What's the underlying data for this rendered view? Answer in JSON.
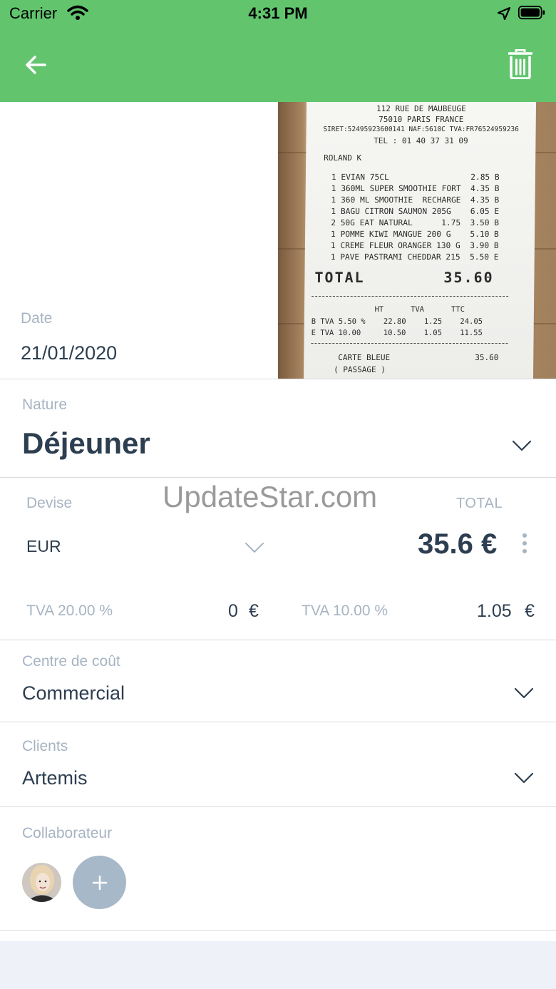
{
  "status_bar": {
    "carrier": "Carrier",
    "time": "4:31 PM"
  },
  "colors": {
    "header": "#62c56e",
    "label": "#a7b4c2",
    "text": "#2d3e50",
    "add_button": "#a7b8c8"
  },
  "icons": {
    "back": "arrow-left-icon",
    "delete": "trash-icon",
    "dropdown": "chevron-down-icon",
    "more": "more-vertical-icon",
    "add": "plus-icon"
  },
  "receipt": {
    "address1": "112 RUE DE MAUBEUGE",
    "address2": "75010 PARIS FRANCE",
    "siret": "SIRET:52495923600141 NAF:5610C TVA:FR76524959236",
    "tel": "TEL : 01 40 37 31 09",
    "cashier": "ROLAND K",
    "items": [
      "1 EVIAN 75CL                 2.85 B",
      "1 360ML SUPER SMOOTHIE FORT  4.35 B",
      "1 360 ML SMOOTHIE  RECHARGE  4.35 B",
      "1 BAGU CITRON SAUMON 205G    6.05 E",
      "2 50G EAT NATURAL      1.75  3.50 B",
      "1 POMME KIWI MANGUE 200 G    5.10 B",
      "1 CREME FLEUR ORANGER 130 G  3.90 B",
      "1 PAVE PASTRAMI CHEDDAR 215  5.50 E"
    ],
    "total_label": "TOTAL",
    "total_value": "35.60",
    "tax_header": "              HT      TVA      TTC",
    "tax_rows": [
      "B TVA 5.50 %    22.80    1.25    24.05",
      "E TVA 10.00     10.50    1.05    11.55"
    ],
    "payment": "CARTE BLEUE                  35.60",
    "payment_sub": "( PASSAGE )"
  },
  "date": {
    "label": "Date",
    "value": "21/01/2020"
  },
  "nature": {
    "label": "Nature",
    "value": "Déjeuner"
  },
  "watermark": "UpdateStar.com",
  "devise": {
    "label": "Devise",
    "value": "EUR"
  },
  "total": {
    "label": "TOTAL",
    "value": "35.6 €"
  },
  "tva": [
    {
      "label": "TVA 20.00 %",
      "value": "0",
      "currency": "€"
    },
    {
      "label": "TVA 10.00 %",
      "value": "1.05",
      "currency": "€"
    }
  ],
  "centre": {
    "label": "Centre de coût",
    "value": "Commercial"
  },
  "clients": {
    "label": "Clients",
    "value": "Artemis"
  },
  "collaborateur": {
    "label": "Collaborateur",
    "add_label": "+"
  }
}
